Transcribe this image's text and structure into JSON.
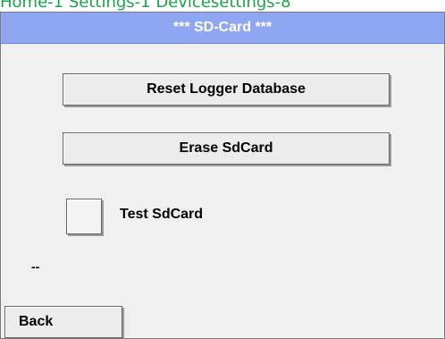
{
  "breadcrumb": "Home-1 Settings-1 Devicesettings-8",
  "screen": {
    "title": "*** SD-Card ***"
  },
  "buttons": {
    "reset_logger_database": "Reset Logger Database",
    "erase_sdcard": "Erase SdCard",
    "back": "Back"
  },
  "test_sdcard": {
    "label": "Test SdCard",
    "checked": false
  },
  "status": "--",
  "colors": {
    "title_bar": "#8fa6f2",
    "screen_bg": "#f0f0f0",
    "breadcrumb": "#1aa34a"
  }
}
